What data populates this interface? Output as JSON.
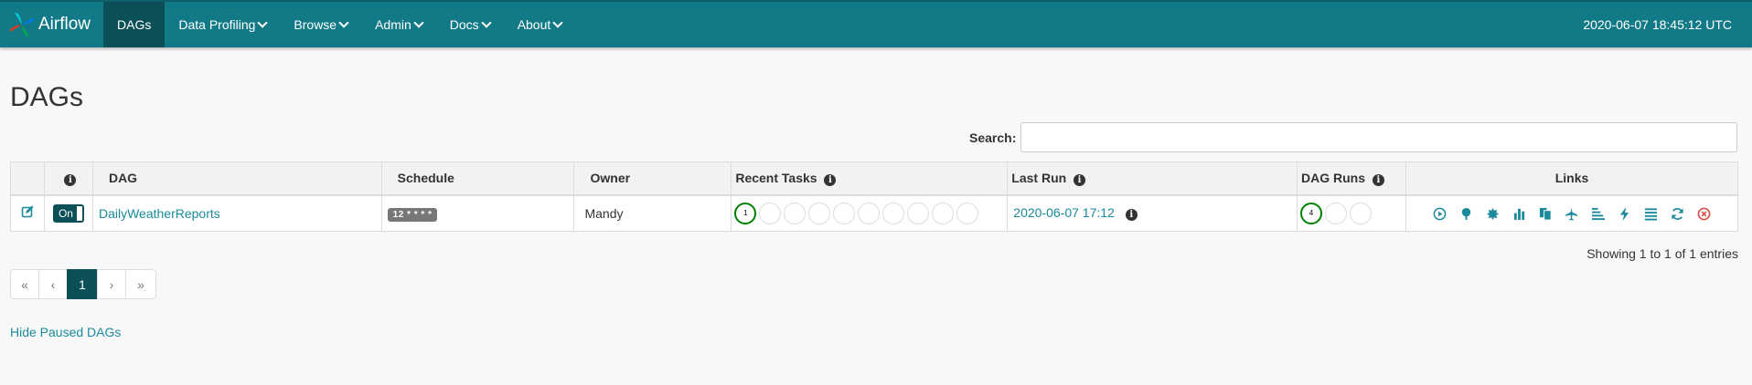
{
  "nav": {
    "brand": "Airflow",
    "items": [
      {
        "label": "DAGs",
        "active": true,
        "dropdown": false
      },
      {
        "label": "Data Profiling",
        "active": false,
        "dropdown": true
      },
      {
        "label": "Browse",
        "active": false,
        "dropdown": true
      },
      {
        "label": "Admin",
        "active": false,
        "dropdown": true
      },
      {
        "label": "Docs",
        "active": false,
        "dropdown": true
      },
      {
        "label": "About",
        "active": false,
        "dropdown": true
      }
    ],
    "datetime": "2020-06-07 18:45:12 UTC"
  },
  "page": {
    "title": "DAGs",
    "search_label": "Search:",
    "search_value": ""
  },
  "table": {
    "headers": {
      "info": "",
      "dag": "DAG",
      "schedule": "Schedule",
      "owner": "Owner",
      "recent_tasks": "Recent Tasks",
      "last_run": "Last Run",
      "dag_runs": "DAG Runs",
      "links": "Links"
    },
    "rows": [
      {
        "toggle": "On",
        "dag_id": "DailyWeatherReports",
        "schedule": "12 * * * *",
        "owner": "Mandy",
        "recent_tasks_success": "1",
        "last_run": "2020-06-07 17:12",
        "dag_runs_success": "4"
      }
    ]
  },
  "entries_text": "Showing 1 to 1 of 1 entries",
  "pagination": {
    "first": "«",
    "prev": "‹",
    "current": "1",
    "next": "›",
    "last": "»"
  },
  "hide_paused": "Hide Paused DAGs",
  "colors": {
    "navbar": "#127a87",
    "navbar_active": "#0b4f57",
    "link": "#1a8a9c",
    "success": "#008000",
    "delete": "#d9534f"
  },
  "icons": {
    "edit": "edit-icon",
    "info": "info-icon",
    "links": [
      "trigger-dag-icon",
      "tree-view-icon",
      "graph-view-icon",
      "task-duration-icon",
      "task-tries-icon",
      "landing-times-icon",
      "gantt-icon",
      "code-icon",
      "logs-icon",
      "refresh-icon",
      "delete-icon"
    ]
  }
}
